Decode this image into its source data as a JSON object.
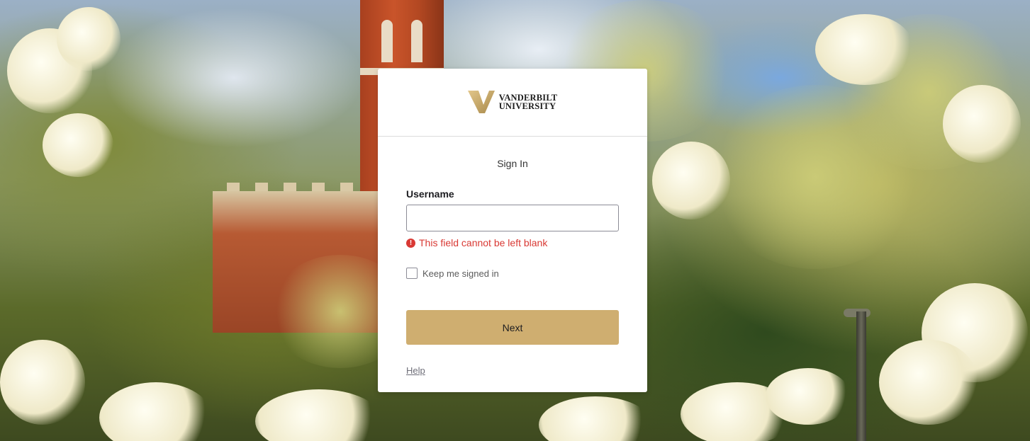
{
  "brand": {
    "line1": "VANDERBILT",
    "line2": "UNIVERSITY",
    "gold": "#cfae70"
  },
  "form": {
    "title": "Sign In",
    "username_label": "Username",
    "username_value": "",
    "error_message": "This field cannot be left blank",
    "keep_signed_in_label": "Keep me signed in",
    "keep_signed_in_checked": false,
    "next_label": "Next",
    "help_label": "Help"
  },
  "colors": {
    "error": "#d93934",
    "button": "#cfae70"
  },
  "icons": {
    "error": "exclamation-circle-icon",
    "logo": "vanderbilt-v-icon"
  }
}
